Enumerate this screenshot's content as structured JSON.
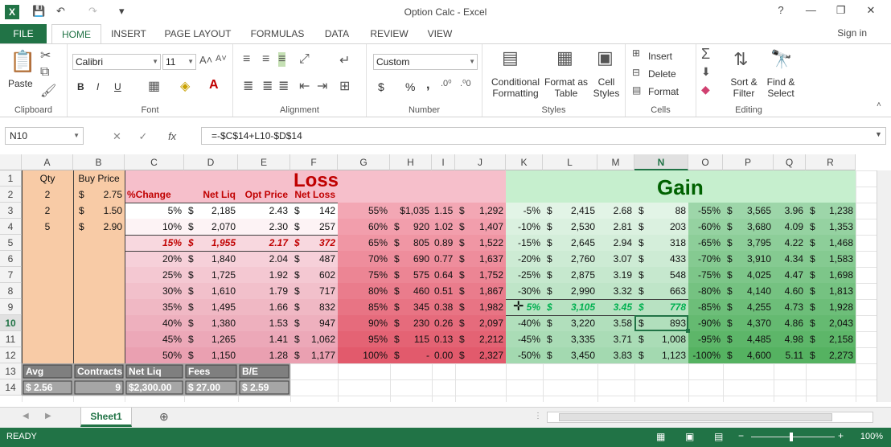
{
  "window": {
    "title": "Option Calc - Excel",
    "help": "?",
    "minimize": "—",
    "restore": "❐",
    "close": "✕"
  },
  "qat": {
    "save": "💾",
    "undo": "↶",
    "redo": "↷",
    "more": "▾"
  },
  "tabs": [
    "FILE",
    "HOME",
    "INSERT",
    "PAGE LAYOUT",
    "FORMULAS",
    "DATA",
    "REVIEW",
    "VIEW"
  ],
  "active_tab": "HOME",
  "signin": "Sign in",
  "ribbon": {
    "clipboard": {
      "label": "Clipboard",
      "paste": "Paste"
    },
    "font": {
      "label": "Font",
      "name": "Calibri",
      "size": "11",
      "bold": "B",
      "italic": "I",
      "underline": "U"
    },
    "alignment": {
      "label": "Alignment"
    },
    "number": {
      "label": "Number",
      "format": "Custom",
      "currency": "$",
      "percent": "%",
      "comma": ","
    },
    "styles": {
      "label": "Styles",
      "cond": "Conditional Formatting",
      "table": "Format as Table",
      "cell": "Cell Styles"
    },
    "cells": {
      "label": "Cells",
      "insert": "Insert",
      "delete": "Delete",
      "format": "Format"
    },
    "editing": {
      "label": "Editing",
      "sort": "Sort & Filter",
      "find": "Find & Select"
    }
  },
  "formula_bar": {
    "name_box": "N10",
    "formula": "=-$C$14+L10-$D$14",
    "fx": "fx"
  },
  "columns": [
    "A",
    "B",
    "C",
    "D",
    "E",
    "F",
    "G",
    "H",
    "I",
    "J",
    "K",
    "L",
    "M",
    "N",
    "O",
    "P",
    "Q",
    "R"
  ],
  "selected_col": "N",
  "rows": [
    "1",
    "2",
    "3",
    "4",
    "5",
    "6",
    "7",
    "8",
    "9",
    "10",
    "11",
    "12",
    "13",
    "14"
  ],
  "selected_row": "10",
  "headers": {
    "qty": "Qty",
    "buy_price": "Buy Price",
    "loss": "Loss",
    "gain": "Gain",
    "pct_change": "%Change",
    "net_liq": "Net Liq",
    "opt_price": "Opt Price",
    "net_loss": "Net Loss"
  },
  "left_block": [
    {
      "qty": "2",
      "bp_sym": "$",
      "bp": "2.75"
    },
    {
      "qty": "2",
      "bp_sym": "$",
      "bp": "1.50"
    },
    {
      "qty": "5",
      "bp_sym": "$",
      "bp": "2.90"
    }
  ],
  "loss1": [
    [
      "5%",
      "$",
      "2,185",
      "2.43",
      "$",
      "142"
    ],
    [
      "10%",
      "$",
      "2,070",
      "2.30",
      "$",
      "257"
    ],
    [
      "15%",
      "$",
      "1,955",
      "2.17",
      "$",
      "372"
    ],
    [
      "20%",
      "$",
      "1,840",
      "2.04",
      "$",
      "487"
    ],
    [
      "25%",
      "$",
      "1,725",
      "1.92",
      "$",
      "602"
    ],
    [
      "30%",
      "$",
      "1,610",
      "1.79",
      "$",
      "717"
    ],
    [
      "35%",
      "$",
      "1,495",
      "1.66",
      "$",
      "832"
    ],
    [
      "40%",
      "$",
      "1,380",
      "1.53",
      "$",
      "947"
    ],
    [
      "45%",
      "$",
      "1,265",
      "1.41",
      "$",
      "1,062"
    ],
    [
      "50%",
      "$",
      "1,150",
      "1.28",
      "$",
      "1,177"
    ]
  ],
  "loss2": [
    [
      "55%",
      "$1,035",
      "1.15",
      "$",
      "1,292"
    ],
    [
      "60%",
      "$",
      "920",
      "1.02",
      "$",
      "1,407"
    ],
    [
      "65%",
      "$",
      "805",
      "0.89",
      "$",
      "1,522"
    ],
    [
      "70%",
      "$",
      "690",
      "0.77",
      "$",
      "1,637"
    ],
    [
      "75%",
      "$",
      "575",
      "0.64",
      "$",
      "1,752"
    ],
    [
      "80%",
      "$",
      "460",
      "0.51",
      "$",
      "1,867"
    ],
    [
      "85%",
      "$",
      "345",
      "0.38",
      "$",
      "1,982"
    ],
    [
      "90%",
      "$",
      "230",
      "0.26",
      "$",
      "2,097"
    ],
    [
      "95%",
      "$",
      "115",
      "0.13",
      "$",
      "2,212"
    ],
    [
      "100%",
      "$",
      "-",
      "0.00",
      "$",
      "2,327"
    ]
  ],
  "gain1": [
    [
      "-5%",
      "$",
      "2,415",
      "2.68",
      "$",
      "88"
    ],
    [
      "-10%",
      "$",
      "2,530",
      "2.81",
      "$",
      "203"
    ],
    [
      "-15%",
      "$",
      "2,645",
      "2.94",
      "$",
      "318"
    ],
    [
      "-20%",
      "$",
      "2,760",
      "3.07",
      "$",
      "433"
    ],
    [
      "-25%",
      "$",
      "2,875",
      "3.19",
      "$",
      "548"
    ],
    [
      "-30%",
      "$",
      "2,990",
      "3.32",
      "$",
      "663"
    ],
    [
      "5%",
      "$",
      "3,105",
      "3.45",
      "$",
      "778"
    ],
    [
      "-40%",
      "$",
      "3,220",
      "3.58",
      "$",
      "893"
    ],
    [
      "-45%",
      "$",
      "3,335",
      "3.71",
      "$",
      "1,008"
    ],
    [
      "-50%",
      "$",
      "3,450",
      "3.83",
      "$",
      "1,123"
    ]
  ],
  "gain2": [
    [
      "-55%",
      "$",
      "3,565",
      "3.96",
      "$",
      "1,238"
    ],
    [
      "-60%",
      "$",
      "3,680",
      "4.09",
      "$",
      "1,353"
    ],
    [
      "-65%",
      "$",
      "3,795",
      "4.22",
      "$",
      "1,468"
    ],
    [
      "-70%",
      "$",
      "3,910",
      "4.34",
      "$",
      "1,583"
    ],
    [
      "-75%",
      "$",
      "4,025",
      "4.47",
      "$",
      "1,698"
    ],
    [
      "-80%",
      "$",
      "4,140",
      "4.60",
      "$",
      "1,813"
    ],
    [
      "-85%",
      "$",
      "4,255",
      "4.73",
      "$",
      "1,928"
    ],
    [
      "-90%",
      "$",
      "4,370",
      "4.86",
      "$",
      "2,043"
    ],
    [
      "-95%",
      "$",
      "4,485",
      "4.98",
      "$",
      "2,158"
    ],
    [
      "-100%",
      "$",
      "4,600",
      "5.11",
      "$",
      "2,273"
    ]
  ],
  "summary": {
    "labels": [
      "Avg",
      "Contracts",
      "Net Liq",
      "Fees",
      "B/E"
    ],
    "values": [
      "$ 2.56",
      "9",
      "$2,300.00",
      "$ 27.00",
      "$ 2.59"
    ]
  },
  "sheet_tab": "Sheet1",
  "status": {
    "ready": "READY",
    "zoom": "100%"
  }
}
